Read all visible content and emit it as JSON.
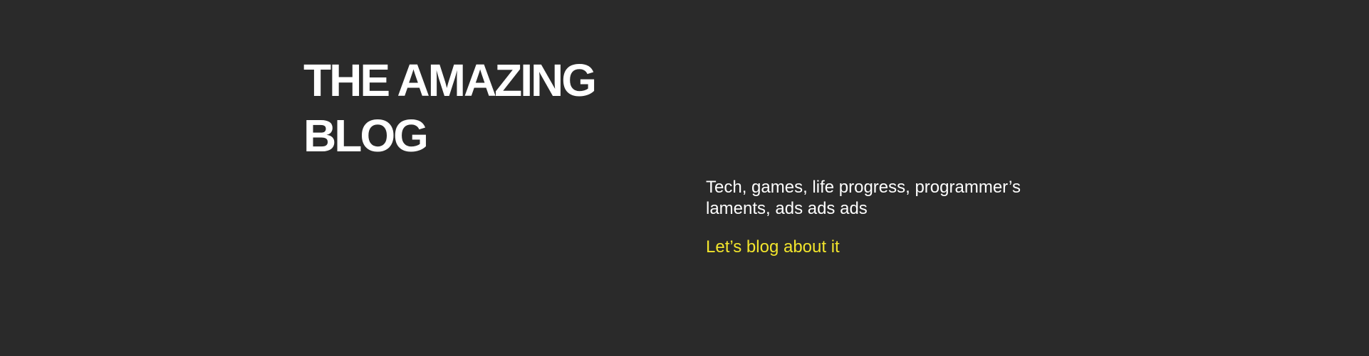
{
  "hero": {
    "title": "THE AMAZING BLOG",
    "tagline": "Tech, games, life progress, programmer’s laments, ads ads ads",
    "cta_label": "Let’s blog about it"
  },
  "colors": {
    "background": "#2a2a2a",
    "text": "#ffffff",
    "accent": "#f2e52c"
  }
}
